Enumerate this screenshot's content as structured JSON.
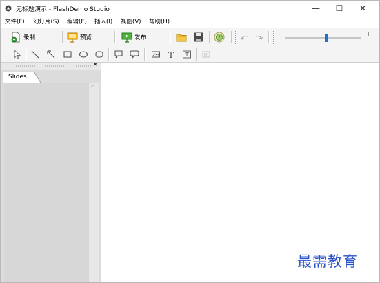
{
  "window": {
    "title": "无标题演示 - FlashDemo Studio",
    "icon": "flashdemo-app-icon",
    "controls": {
      "minimize": "—",
      "maximize": "☐",
      "close": "✕"
    }
  },
  "menubar": {
    "items": [
      {
        "label": "文件(F)"
      },
      {
        "label": "幻灯片(S)"
      },
      {
        "label": "编辑(E)"
      },
      {
        "label": "插入(I)"
      },
      {
        "label": "视图(V)"
      },
      {
        "label": "帮助(H)"
      }
    ]
  },
  "toolbar": {
    "record_label": "录制",
    "preview_label": "预览",
    "publish_label": "发布",
    "icons": [
      "open-folder-icon",
      "save-icon",
      "help-icon",
      "undo-icon",
      "redo-icon"
    ],
    "zoom_slider": {
      "minus": "-",
      "plus": "+",
      "value": 0.55
    }
  },
  "drawing_toolbar": {
    "tools": [
      "select-arrow-icon",
      "line-icon",
      "arrow-line-icon",
      "rectangle-icon",
      "ellipse-icon",
      "rounded-rectangle-icon",
      "speech-bubble-icon",
      "callout-bubble-icon",
      "image-icon",
      "text-icon",
      "text-box-icon",
      "frame-icon"
    ]
  },
  "slides_panel": {
    "tab_label": "Slides",
    "close": "×"
  },
  "watermark": {
    "text": "最需教育"
  },
  "colors": {
    "accent": "#2a52c8",
    "panel_bg": "#dcdcdc",
    "toolbar_bg": "#f4f4f4"
  }
}
